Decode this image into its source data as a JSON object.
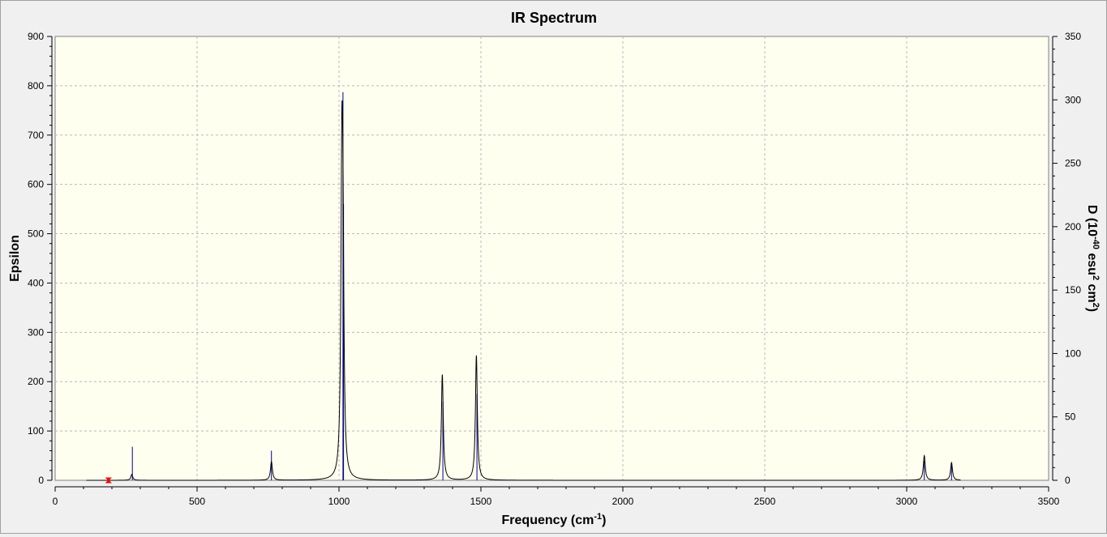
{
  "chart_data": {
    "type": "line",
    "title": "IR Spectrum",
    "xlabel": {
      "base": "Frequency (cm",
      "sup": "-1",
      "end": ")"
    },
    "ylabel_left": "Epsilon",
    "ylabel_right": {
      "a": "D (10",
      "sup1": "-40",
      "b": " esu",
      "sup2": "2",
      "c": " cm",
      "sup3": "2",
      "d": ")"
    },
    "xlim": [
      0,
      3500
    ],
    "ylim_left": [
      0,
      900
    ],
    "ylim_right": [
      0,
      350
    ],
    "xticks": [
      0,
      500,
      1000,
      1500,
      2000,
      2500,
      3000,
      3500
    ],
    "yticks_left": [
      0,
      100,
      200,
      300,
      400,
      500,
      600,
      700,
      800,
      900
    ],
    "yticks_right": [
      0,
      50,
      100,
      150,
      200,
      250,
      300,
      350
    ],
    "grid": true,
    "curve_x_range": [
      110,
      3190
    ],
    "peak_halfwidth": 4,
    "spectrum_peaks": [
      {
        "x": 270,
        "epsilon": 12
      },
      {
        "x": 762,
        "epsilon": 38
      },
      {
        "x": 1010,
        "epsilon": 560
      },
      {
        "x": 1014,
        "epsilon": 380
      },
      {
        "x": 1364,
        "epsilon": 214
      },
      {
        "x": 1484,
        "epsilon": 253
      },
      {
        "x": 3062,
        "epsilon": 50
      },
      {
        "x": 3158,
        "epsilon": 36
      }
    ],
    "stick_series": [
      {
        "x": 272,
        "epsilon": 68
      },
      {
        "x": 762,
        "epsilon": 60
      },
      {
        "x": 1014,
        "epsilon": 787
      },
      {
        "x": 1016,
        "epsilon": 560
      },
      {
        "x": 1366,
        "epsilon": 160
      },
      {
        "x": 1486,
        "epsilon": 175
      },
      {
        "x": 3062,
        "epsilon": 40
      },
      {
        "x": 3158,
        "epsilon": 30
      }
    ],
    "marker": {
      "x": 188,
      "epsilon": 0
    },
    "colors": {
      "plot_background": "#fffff0",
      "curve": "#000000",
      "sticks": "#00008b",
      "marker": "#ff0000",
      "grid": "#b8b8b8"
    }
  }
}
